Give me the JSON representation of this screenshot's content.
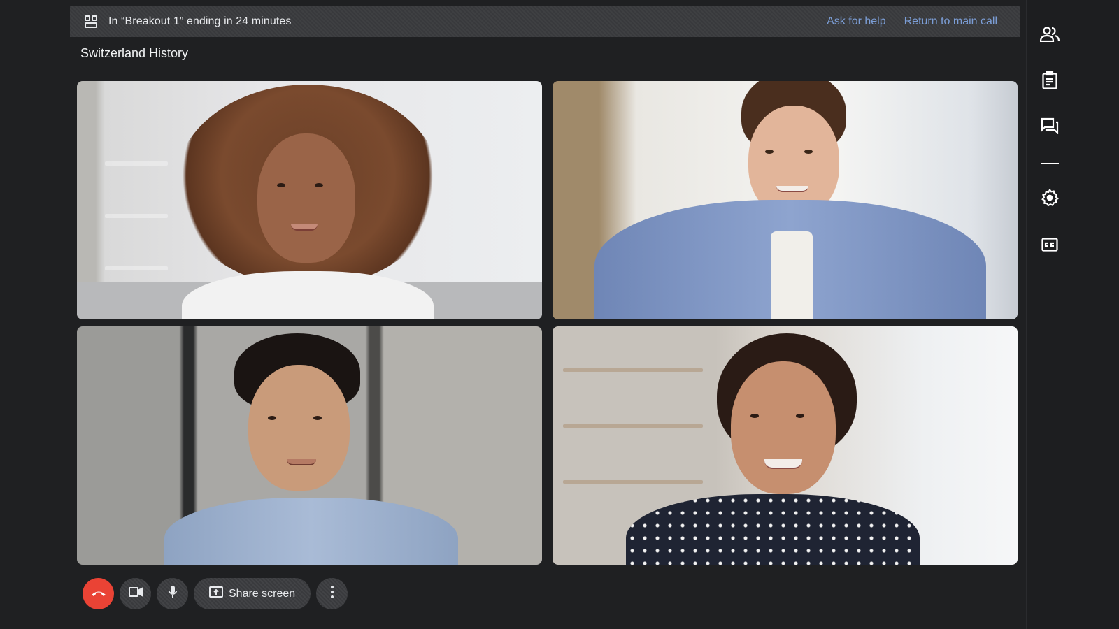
{
  "banner": {
    "icon": "breakout-rooms-icon",
    "text": "In “Breakout 1” ending in 24 minutes",
    "ask_for_help": "Ask for help",
    "return_to_main": "Return to main call"
  },
  "meeting": {
    "title": "Switzerland History"
  },
  "tiles": [
    {
      "id": "participant-1",
      "desc": "woman with curly hair, white shirt"
    },
    {
      "id": "participant-2",
      "desc": "young man, blue denim shirt"
    },
    {
      "id": "participant-3",
      "desc": "young man, light blue shirt"
    },
    {
      "id": "participant-4",
      "desc": "woman smiling, polka-dot top"
    }
  ],
  "controls": {
    "end_call": "end-call-icon",
    "camera": "camera-icon",
    "microphone": "microphone-icon",
    "share_screen_label": "Share screen",
    "more": "more-options-icon"
  },
  "side_rail": [
    "people-icon",
    "activities-clipboard-icon",
    "chat-icon",
    "divider",
    "settings-icon",
    "captions-icon"
  ],
  "colors": {
    "background": "#1f2022",
    "banner": "#3a3b3e",
    "link": "#8ab4f8",
    "end_call": "#ea4335",
    "control": "#3c3d40"
  }
}
